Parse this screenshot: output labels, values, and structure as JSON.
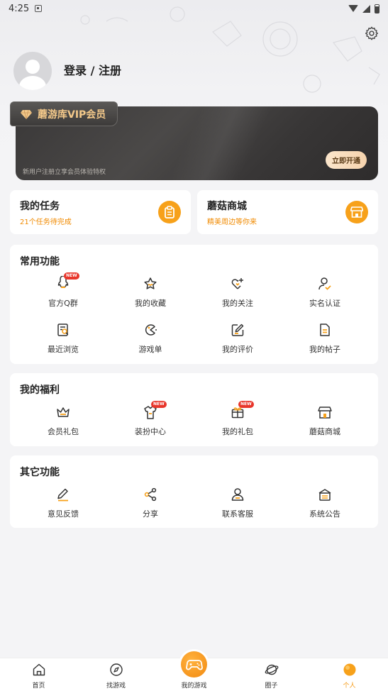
{
  "status_bar": {
    "time": "4:25"
  },
  "profile": {
    "login_text": "登录 / 注册"
  },
  "vip": {
    "title": "蘑游库VIP会员",
    "subtitle": "新用户注册立享会员体验特权",
    "button": "立即开通"
  },
  "quick_cards": [
    {
      "title": "我的任务",
      "subtitle": "21个任务待完成",
      "icon": "clipboard-icon"
    },
    {
      "title": "蘑菇商城",
      "subtitle": "精美周边等你来",
      "icon": "store-icon"
    }
  ],
  "common": {
    "title": "常用功能",
    "items": [
      {
        "label": "官方Q群",
        "icon": "qq-group-icon",
        "badge": "NEW"
      },
      {
        "label": "我的收藏",
        "icon": "star-icon"
      },
      {
        "label": "我的关注",
        "icon": "heart-plus-icon"
      },
      {
        "label": "实名认证",
        "icon": "user-check-icon"
      },
      {
        "label": "最近浏览",
        "icon": "history-icon"
      },
      {
        "label": "游戏单",
        "icon": "pacman-icon"
      },
      {
        "label": "我的评价",
        "icon": "edit-icon"
      },
      {
        "label": "我的帖子",
        "icon": "document-icon"
      }
    ]
  },
  "welfare": {
    "title": "我的福利",
    "items": [
      {
        "label": "会员礼包",
        "icon": "crown-icon"
      },
      {
        "label": "装扮中心",
        "icon": "shirt-icon",
        "badge": "NEW"
      },
      {
        "label": "我的礼包",
        "icon": "gift-icon",
        "badge": "NEW"
      },
      {
        "label": "蘑菇商城",
        "icon": "store-icon"
      }
    ]
  },
  "other": {
    "title": "其它功能",
    "items": [
      {
        "label": "意见反馈",
        "icon": "pencil-icon"
      },
      {
        "label": "分享",
        "icon": "share-icon"
      },
      {
        "label": "联系客服",
        "icon": "person-icon"
      },
      {
        "label": "系统公告",
        "icon": "announcement-icon"
      }
    ]
  },
  "tabs": [
    {
      "label": "首页",
      "icon": "home-icon"
    },
    {
      "label": "找游戏",
      "icon": "compass-icon"
    },
    {
      "label": "我的游戏",
      "icon": "gamepad-icon"
    },
    {
      "label": "圈子",
      "icon": "planet-icon"
    },
    {
      "label": "个人",
      "icon": "profile-icon",
      "active": true
    }
  ],
  "colors": {
    "accent": "#F59A16",
    "badge": "#E8362B",
    "vip_gold": "#F4C98A"
  }
}
